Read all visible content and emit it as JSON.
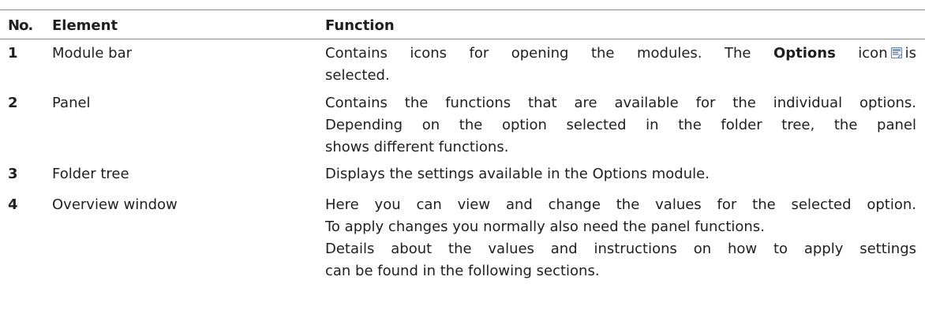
{
  "table": {
    "headers": {
      "no": "No.",
      "element": "Element",
      "function": "Function"
    },
    "rows": [
      {
        "no": "1",
        "element": "Module bar",
        "function": {
          "line1_before": "Contains icons for opening the modules. The ",
          "line1_bold": "Options",
          "line1_after": " icon",
          "line1_tail": "is",
          "line2": "selected.",
          "icon": "options-icon"
        }
      },
      {
        "no": "2",
        "element": "Panel",
        "function": {
          "lines": [
            "Contains the functions that are available for the individual options.",
            "Depending on the option selected in the folder tree, the panel",
            "shows different functions."
          ]
        }
      },
      {
        "no": "3",
        "element": "Folder tree",
        "function": {
          "lines": [
            "Displays the settings available in the Options module."
          ]
        }
      },
      {
        "no": "4",
        "element": "Overview window",
        "function": {
          "lines": [
            "Here you can view and change the values for the selected option.",
            "To apply changes you normally also need the panel functions.",
            "Details about the values and instructions on how to apply settings",
            "can be found in the following sections."
          ]
        }
      }
    ]
  }
}
